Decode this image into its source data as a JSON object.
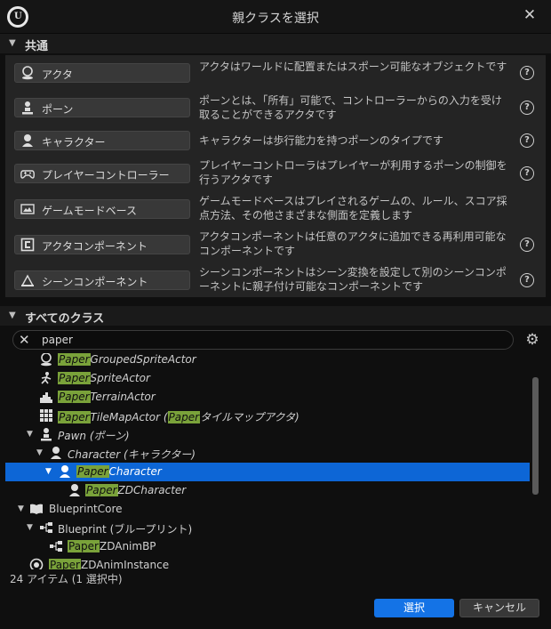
{
  "window": {
    "title": "親クラスを選択"
  },
  "common": {
    "header": "共通",
    "items": [
      {
        "label": "アクタ",
        "icon": "actor-icon",
        "desc": "アクタはワールドに配置またはスポーン可能なオブジェクトです"
      },
      {
        "label": "ポーン",
        "icon": "pawn-icon",
        "desc": "ポーンとは、「所有」可能で、コントローラーからの入力を受け取ることができるアクタです"
      },
      {
        "label": "キャラクター",
        "icon": "character-icon",
        "desc": "キャラクターは歩行能力を持つポーンのタイプです"
      },
      {
        "label": "プレイヤーコントローラー",
        "icon": "gamepad-icon",
        "desc": "プレイヤーコントローラはプレイヤーが利用するポーンの制御を行うアクタです"
      },
      {
        "label": "ゲームモードベース",
        "icon": "gamemode-icon",
        "desc": "ゲームモードベースはプレイされるゲームの、ルール、スコア採点方法、その他さまざまな側面を定義します"
      },
      {
        "label": "アクタコンポーネント",
        "icon": "actor-component-icon",
        "desc": "アクタコンポーネントは任意のアクタに追加できる再利用可能なコンポーネントです"
      },
      {
        "label": "シーンコンポーネント",
        "icon": "scene-component-icon",
        "desc": "シーンコンポーネントはシーン変換を設定して別のシーンコンポーネントに親子付け可能なコンポーネントです"
      }
    ]
  },
  "all_classes": {
    "header": "すべてのクラス",
    "search": {
      "value": "paper"
    },
    "tree": [
      {
        "hl": "Paper",
        "rest": "GroupedSpriteActor"
      },
      {
        "hl": "Paper",
        "rest": "SpriteActor"
      },
      {
        "hl": "Paper",
        "rest": "TerrainActor"
      },
      {
        "hl": "Paper",
        "rest": "TileMapActor (",
        "hl2": "Paper",
        "rest2": "タイルマップアクタ)"
      },
      {
        "text": "Pawn (ポーン)"
      },
      {
        "text": "Character (キャラクター)"
      },
      {
        "hl": "Paper",
        "rest": "Character"
      },
      {
        "hl": "Paper",
        "rest": "ZDCharacter"
      },
      {
        "text": "BlueprintCore"
      },
      {
        "text": "Blueprint (ブループリント)"
      },
      {
        "hl": "Paper",
        "rest": "ZDAnimBP"
      },
      {
        "hl": "Paper",
        "rest": "ZDAnimInstance"
      }
    ]
  },
  "status": "24 アイテム (1 選択中)",
  "buttons": {
    "select": "選択",
    "cancel": "キャンセル"
  }
}
